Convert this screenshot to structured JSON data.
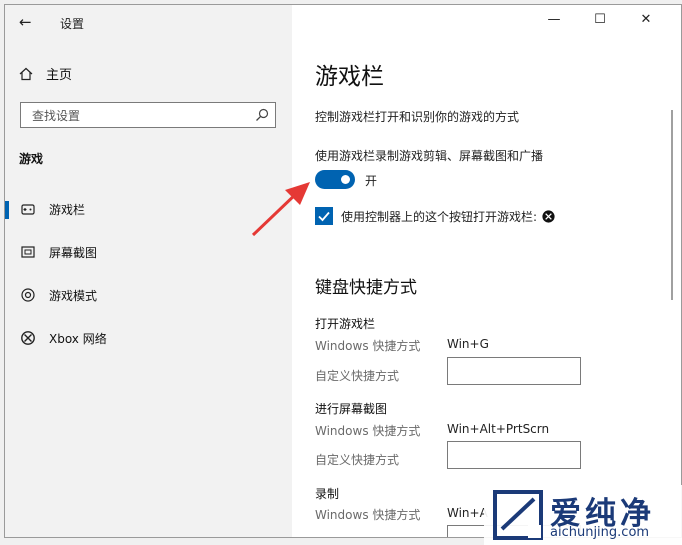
{
  "window": {
    "title": "设置",
    "back_glyph": "←",
    "controls": [
      "—",
      "☐",
      "✕"
    ]
  },
  "sidebar": {
    "home_label": "主页",
    "search_placeholder": "查找设置",
    "section": "游戏",
    "items": [
      {
        "label": "游戏栏",
        "icon": "gamebar-icon",
        "active": true
      },
      {
        "label": "屏幕截图",
        "icon": "screenshot-icon",
        "active": false
      },
      {
        "label": "游戏模式",
        "icon": "gamemode-icon",
        "active": false
      },
      {
        "label": "Xbox 网络",
        "icon": "xbox-icon",
        "active": false
      }
    ]
  },
  "main": {
    "title": "游戏栏",
    "description": "控制游戏栏打开和识别你的游戏的方式",
    "toggle_label": "使用游戏栏录制游戏剪辑、屏幕截图和广播",
    "toggle_state": "开",
    "toggle_on": true,
    "checkbox_label": "使用控制器上的这个按钮打开游戏栏:",
    "checkbox_checked": true,
    "shortcuts_heading": "键盘快捷方式",
    "groups": [
      {
        "name": "打开游戏栏",
        "windows_label": "Windows 快捷方式",
        "windows_value": "Win+G",
        "custom_label": "自定义快捷方式"
      },
      {
        "name": "进行屏幕截图",
        "windows_label": "Windows 快捷方式",
        "windows_value": "Win+Alt+PrtScrn",
        "custom_label": "自定义快捷方式"
      },
      {
        "name": "录制",
        "windows_label": "Windows 快捷方式",
        "windows_value": "Win+A",
        "custom_label": ""
      }
    ]
  },
  "watermark": {
    "name": "爱纯净",
    "domain": "aichunjing.com"
  },
  "colors": {
    "accent": "#0063b1",
    "annotation": "#e53935"
  }
}
